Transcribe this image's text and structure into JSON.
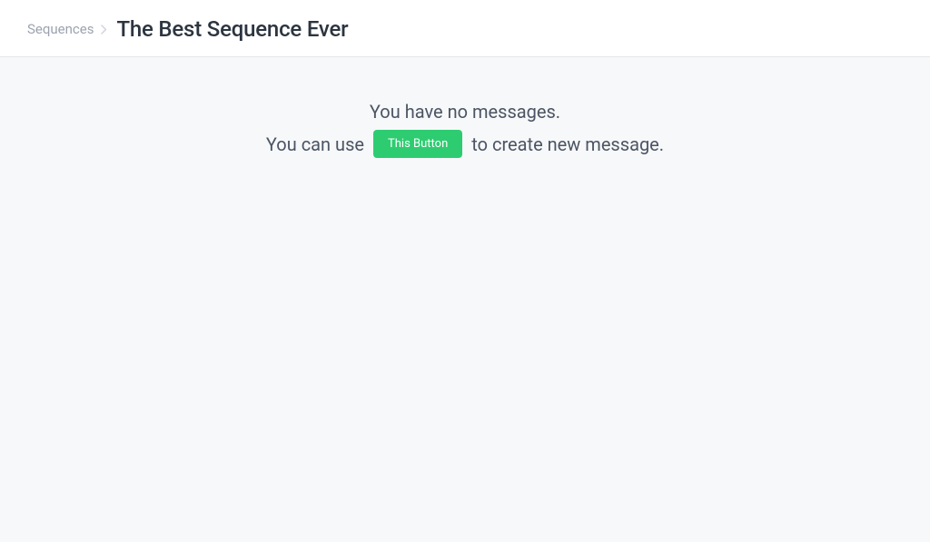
{
  "breadcrumb": {
    "parent_label": "Sequences",
    "current_title": "The Best Sequence Ever"
  },
  "empty_state": {
    "line1": "You have no messages.",
    "line2_prefix": "You can use",
    "button_label": "This Button",
    "line2_suffix": "to create new message."
  }
}
